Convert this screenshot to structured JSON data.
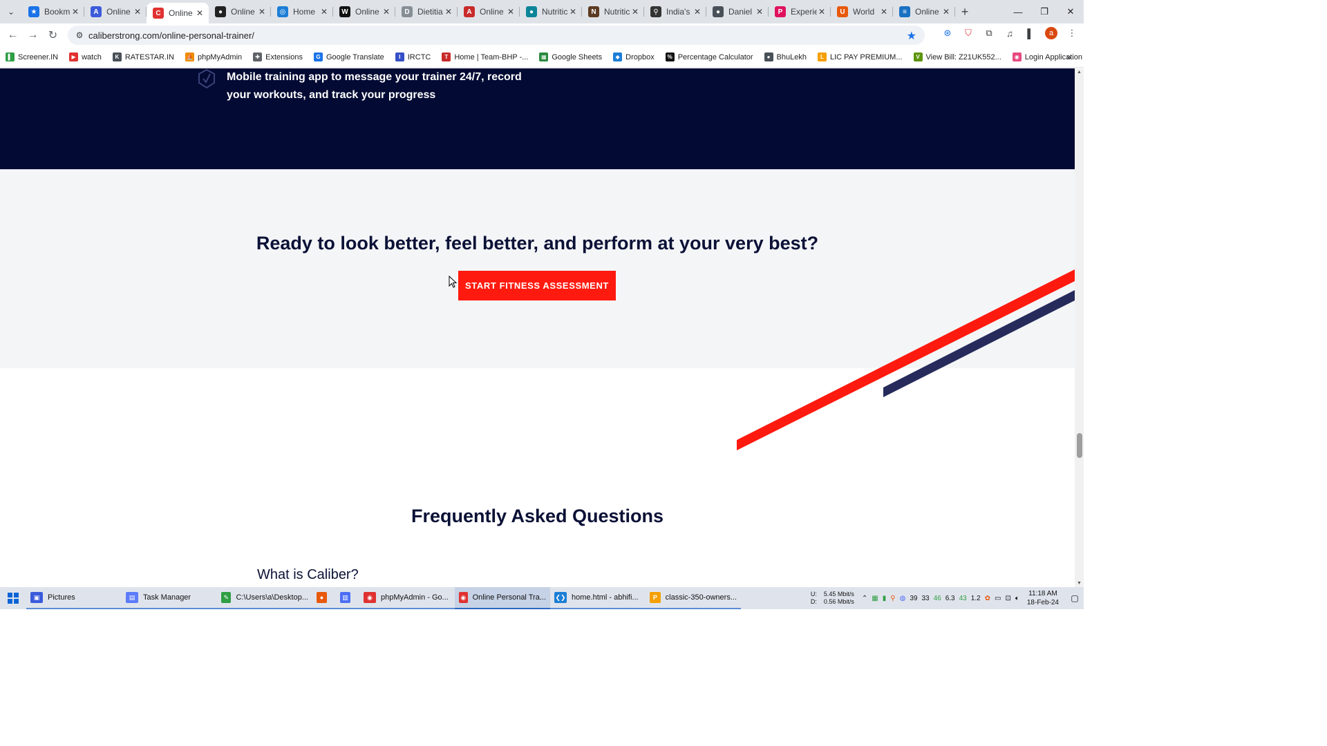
{
  "browser": {
    "tabs": [
      {
        "title": "Bookm",
        "color": "#1a73e8",
        "glyph": "★"
      },
      {
        "title": "Online",
        "color": "#3b5bdb",
        "glyph": "A"
      },
      {
        "title": "Online",
        "color": "#e03131",
        "glyph": "C",
        "active": true
      },
      {
        "title": "Online",
        "color": "#222222",
        "glyph": "●"
      },
      {
        "title": "Home",
        "color": "#1c7ed6",
        "glyph": "◎"
      },
      {
        "title": "Online",
        "color": "#111111",
        "glyph": "W"
      },
      {
        "title": "Dietitia",
        "color": "#868e96",
        "glyph": "D"
      },
      {
        "title": "Online",
        "color": "#c92a2a",
        "glyph": "A"
      },
      {
        "title": "Nutritic",
        "color": "#0c8599",
        "glyph": "●"
      },
      {
        "title": "Nutritic",
        "color": "#5c3a21",
        "glyph": "N"
      },
      {
        "title": "India's",
        "color": "#333333",
        "glyph": "⚲"
      },
      {
        "title": "Daniel",
        "color": "#495057",
        "glyph": "●"
      },
      {
        "title": "Experie",
        "color": "#e0115f",
        "glyph": "P"
      },
      {
        "title": "World",
        "color": "#e8590c",
        "glyph": "U"
      },
      {
        "title": "Online",
        "color": "#1971c2",
        "glyph": "≡"
      }
    ],
    "url": "caliberstrong.com/online-personal-trainer/",
    "profile_initial": "a"
  },
  "bookmarks": [
    {
      "label": "Screener.IN",
      "color": "#2f9e44",
      "glyph": "▌"
    },
    {
      "label": "watch",
      "color": "#e03131",
      "glyph": "▶"
    },
    {
      "label": "RATESTAR.IN",
      "color": "#495057",
      "glyph": "K"
    },
    {
      "label": "phpMyAdmin",
      "color": "#f08c00",
      "glyph": "⛵"
    },
    {
      "label": "Extensions",
      "color": "#5f6368",
      "glyph": "✚"
    },
    {
      "label": "Google Translate",
      "color": "#1a73e8",
      "glyph": "G"
    },
    {
      "label": "IRCTC",
      "color": "#364fc7",
      "glyph": "I"
    },
    {
      "label": "Home | Team-BHP -...",
      "color": "#c92a2a",
      "glyph": "T"
    },
    {
      "label": "Google Sheets",
      "color": "#2b8a3e",
      "glyph": "▦"
    },
    {
      "label": "Dropbox",
      "color": "#1c7ed6",
      "glyph": "◆"
    },
    {
      "label": "Percentage Calculator",
      "color": "#111111",
      "glyph": "%"
    },
    {
      "label": "BhuLekh",
      "color": "#495057",
      "glyph": "●"
    },
    {
      "label": "LIC PAY PREMIUM...",
      "color": "#f59f00",
      "glyph": "L"
    },
    {
      "label": "View Bill: Z21UK552...",
      "color": "#5c940d",
      "glyph": "V"
    },
    {
      "label": "Login Application",
      "color": "#e64980",
      "glyph": "◉"
    }
  ],
  "page": {
    "feature_text": "Mobile training app to message your trainer 24/7,  record your workouts, and track your progress",
    "cta_heading": "Ready to look better, feel better, and perform at your very best?",
    "cta_button": "START FITNESS ASSESSMENT",
    "faq_heading": "Frequently Asked Questions",
    "faq_question_1": "What is Caliber?",
    "colors": {
      "navy": "#030a33",
      "red": "#ff1a0f",
      "stripe_navy": "#262b5c",
      "section_bg": "#f4f5f7"
    }
  },
  "taskbar": {
    "items": [
      {
        "label": "Pictures",
        "color": "#3b5bdb",
        "glyph": "▣"
      },
      {
        "label": "Task Manager",
        "color": "#5c7cfa",
        "glyph": "▤"
      },
      {
        "label": "C:\\Users\\a\\Desktop...",
        "color": "#2f9e44",
        "glyph": "✎"
      },
      {
        "label": "",
        "color": "#e8590c",
        "glyph": "●"
      },
      {
        "label": "",
        "color": "#4c6ef5",
        "glyph": "▥"
      },
      {
        "label": "phpMyAdmin - Go...",
        "color": "#e03131",
        "glyph": "◉"
      },
      {
        "label": "Online Personal Tra...",
        "color": "#e03131",
        "glyph": "◉",
        "active": true
      },
      {
        "label": "home.html - abhifi...",
        "color": "#1c7ed6",
        "glyph": "❮❯"
      },
      {
        "label": "classic-350-owners...",
        "color": "#f59f00",
        "glyph": "P"
      }
    ],
    "net_up_label": "U:",
    "net_up": "5.45 Mbit/s",
    "net_down_label": "D:",
    "net_down": "0.56 Mbit/s",
    "tray_numbers": [
      "39",
      "33",
      "46",
      "6.3",
      "43",
      "1.2"
    ],
    "time": "11:18 AM",
    "date": "18-Feb-24"
  }
}
